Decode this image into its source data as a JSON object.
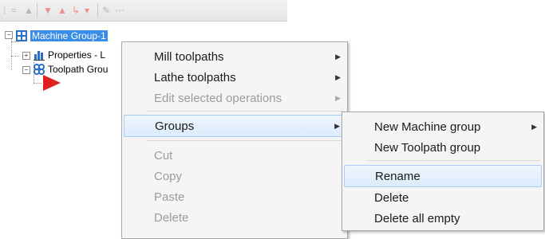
{
  "tree": {
    "root": {
      "label": "Machine Group-1"
    },
    "children": [
      {
        "label": "Properties - L"
      },
      {
        "label": "Toolpath Grou"
      }
    ]
  },
  "context_menu": {
    "items": [
      {
        "label": "Mill toolpaths",
        "submenu": true,
        "disabled": false
      },
      {
        "label": "Lathe toolpaths",
        "submenu": true,
        "disabled": false
      },
      {
        "label": "Edit selected operations",
        "submenu": true,
        "disabled": true
      },
      {
        "label": "Groups",
        "submenu": true,
        "disabled": false,
        "highlighted": true
      },
      {
        "label": "Cut",
        "disabled": true
      },
      {
        "label": "Copy",
        "disabled": true
      },
      {
        "label": "Paste",
        "disabled": true
      },
      {
        "label": "Delete",
        "disabled": true
      }
    ]
  },
  "groups_submenu": {
    "items": [
      {
        "label": "New Machine group",
        "submenu": true
      },
      {
        "label": "New Toolpath group",
        "submenu": false
      },
      {
        "label": "Rename",
        "highlighted": true
      },
      {
        "label": "Delete"
      },
      {
        "label": "Delete all empty"
      }
    ]
  },
  "colors": {
    "selection": "#3a8ee6",
    "menu_bg": "#f5f5f5",
    "hover": "#dcebfc",
    "marker": "#e02020"
  }
}
